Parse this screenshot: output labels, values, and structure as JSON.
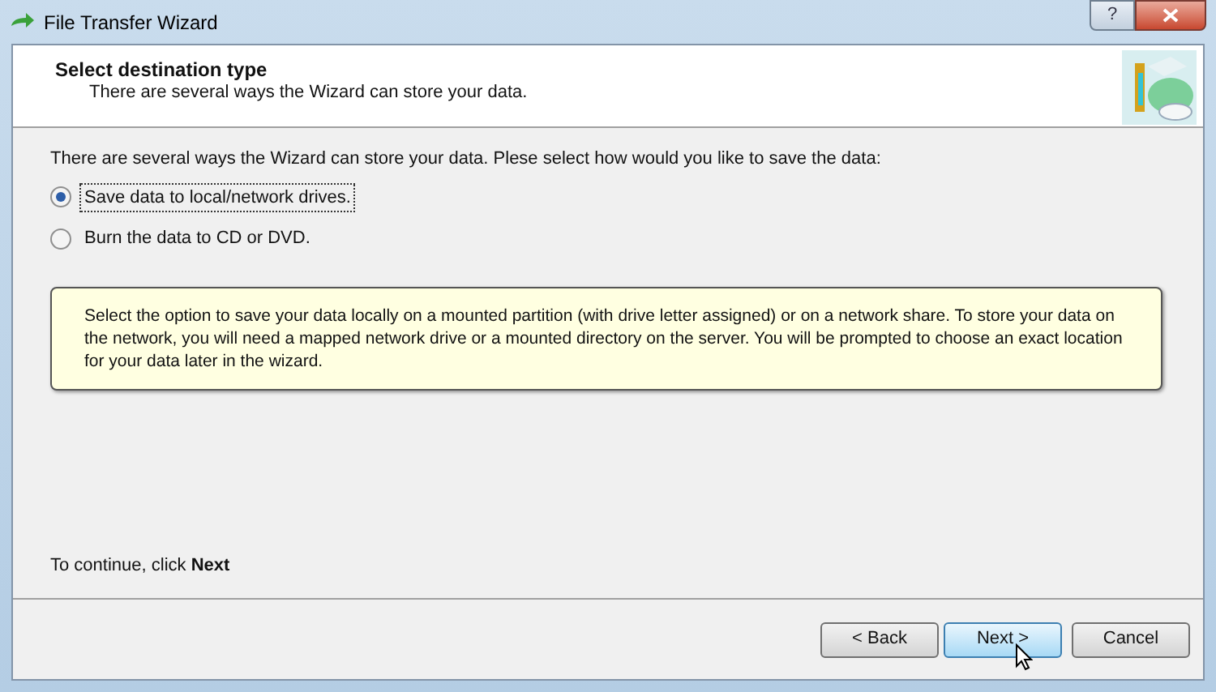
{
  "window": {
    "title": "File Transfer Wizard",
    "help_button": "?"
  },
  "header": {
    "title": "Select destination type",
    "subtitle": "There are several ways the Wizard can store your data."
  },
  "prompt": "There are several ways the Wizard can store your data. Plese select how would you like to save the data:",
  "options": [
    {
      "label": "Save data to local/network drives.",
      "selected": true
    },
    {
      "label": "Burn the data to CD or DVD.",
      "selected": false
    }
  ],
  "info": "Select the option to save your data locally on a mounted partition (with drive letter assigned) or on a network share. To store your data on the network, you will need a mapped network drive or a mounted directory on the server. You will be prompted to choose an exact location for your data later in the wizard.",
  "continue_hint": "To continue, click **Next**",
  "buttons": [
    {
      "label": "< Back",
      "default": false
    },
    {
      "label": "Next >",
      "default": true
    },
    {
      "label": "Cancel",
      "default": false
    }
  ]
}
